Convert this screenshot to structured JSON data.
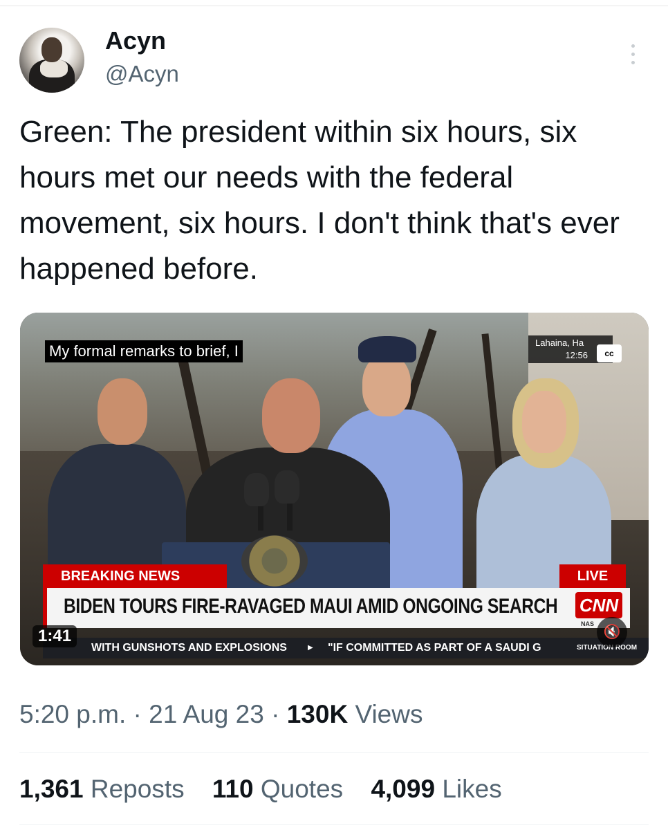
{
  "author": {
    "display_name": "Acyn",
    "handle": "@Acyn"
  },
  "tweet": {
    "text": "Green: The president within six hours, six hours met our needs with the federal movement, six hours. I don't think that's ever happened before."
  },
  "video": {
    "caption": "My formal remarks to brief, I",
    "location": "Lahaina, Ha",
    "clock": "12:56",
    "cc_label": "cc",
    "breaking_label": "BREAKING NEWS",
    "live_label": "LIVE",
    "headline": "BIDEN TOURS FIRE-RAVAGED MAUI AMID ONGOING SEARCH",
    "network": "CNN",
    "nas": "NAS",
    "ticker_left": "WITH GUNSHOTS AND EXPLOSIONS",
    "ticker_right": "\"IF COMMITTED AS PART OF A SAUDI G",
    "ticker_tag": "SITUATION ROOM",
    "duration": "1:41",
    "mute_icon": "speaker-muted-icon"
  },
  "meta": {
    "time": "5:20 p.m.",
    "date": "21 Aug 23",
    "views_count": "130K",
    "views_label": "Views"
  },
  "stats": {
    "reposts_count": "1,361",
    "reposts_label": "Reposts",
    "quotes_count": "110",
    "quotes_label": "Quotes",
    "likes_count": "4,099",
    "likes_label": "Likes"
  },
  "colors": {
    "text_primary": "#0f1419",
    "text_secondary": "#536471",
    "breaking_red": "#cc0000"
  }
}
